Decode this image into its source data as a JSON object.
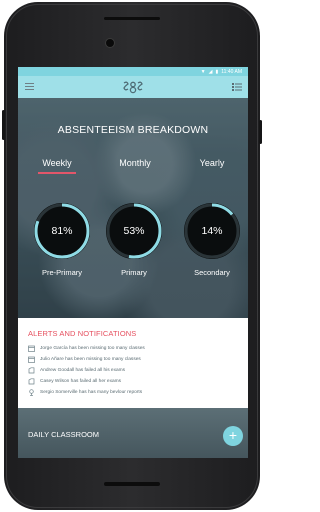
{
  "status_bar": {
    "time": "11:40 AM"
  },
  "app": {
    "title": "ABSENTEEISM BREAKDOWN",
    "tabs": [
      {
        "label": "Weekly",
        "active": true
      },
      {
        "label": "Monthly",
        "active": false
      },
      {
        "label": "Yearly",
        "active": false
      }
    ],
    "gauges": [
      {
        "label": "Pre-Primary",
        "value_text": "81%",
        "value": 81
      },
      {
        "label": "Primary",
        "value_text": "53%",
        "value": 53
      },
      {
        "label": "Secondary",
        "value_text": "14%",
        "value": 14
      }
    ]
  },
  "alerts": {
    "title": "ALERTS AND NOTIFICATIONS",
    "items": [
      {
        "icon": "calendar-icon",
        "text": "Jorge García has been missing too many classes"
      },
      {
        "icon": "calendar-icon",
        "text": "Julio Añare has been missing too many classes"
      },
      {
        "icon": "exam-icon",
        "text": "Andrew Goodall has failed all his exams"
      },
      {
        "icon": "exam-icon",
        "text": "Casey Wilson has failed all her exams"
      },
      {
        "icon": "behaviour-icon",
        "text": "Sergio Somerville has has many bevlour reports"
      }
    ]
  },
  "daily": {
    "title": "DAILY CLASSROOM",
    "fab_label": "+"
  },
  "colors": {
    "accent": "#7fd4df",
    "appbar": "#9fe0e8",
    "alert_title": "#e6505f",
    "tab_underline": "#e3566a"
  }
}
